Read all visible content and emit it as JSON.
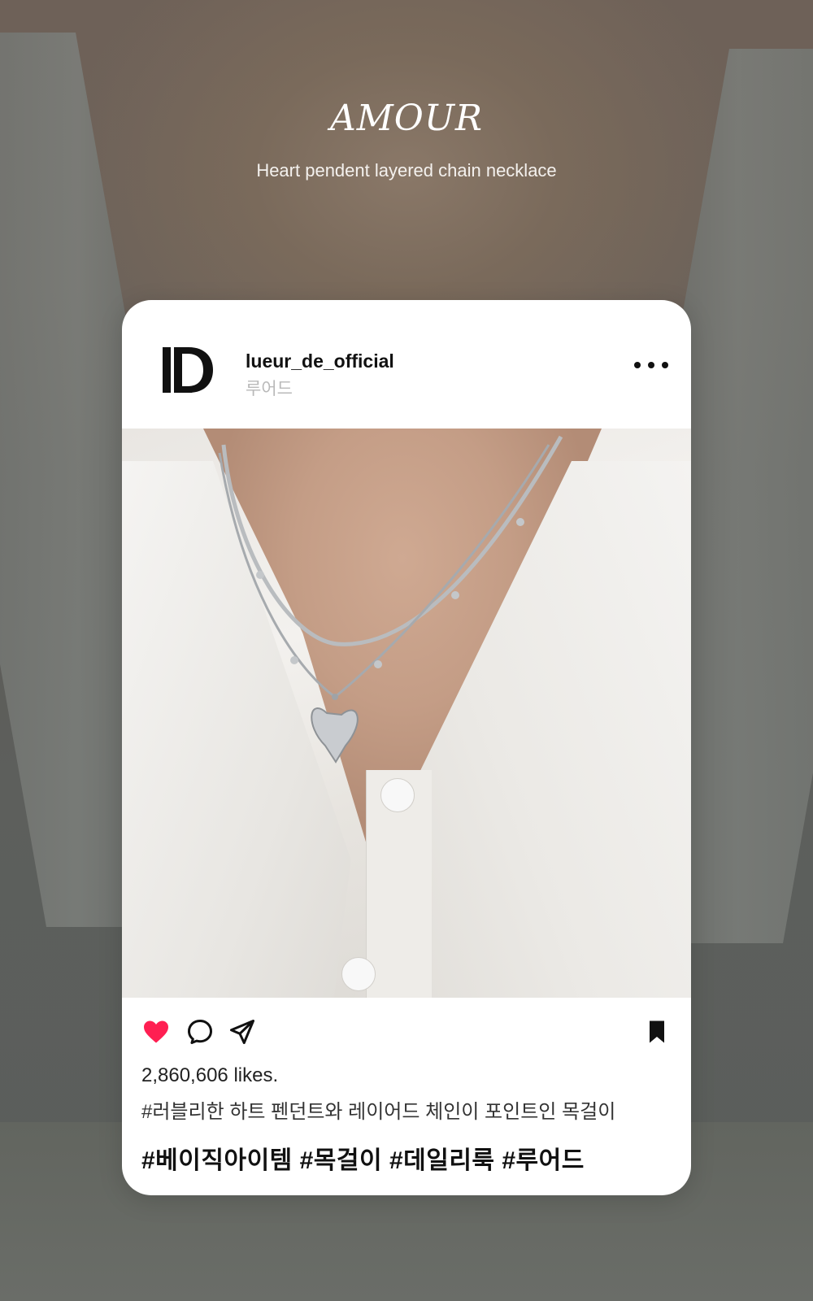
{
  "hero": {
    "title": "AMOUR",
    "subtitle": "Heart pendent layered chain necklace"
  },
  "post": {
    "logo": "ID",
    "username": "lueur_de_official",
    "subname": "루어드",
    "more_icon": "more-horizontal-icon",
    "image_alt": "Model wearing a layered silver chain necklace with a heart pendant over a white shirt",
    "actions": {
      "like_icon": "heart-icon",
      "comment_icon": "comment-icon",
      "share_icon": "send-icon",
      "bookmark_icon": "bookmark-icon",
      "like_color": "#ff1f52"
    },
    "likes": "2,860,606 likes.",
    "caption": "#러블리한 하트 펜던트와 레이어드 체인이 포인트인 목걸이",
    "tags": "#베이직아이템 #목걸이 #데일리룩 #루어드"
  }
}
